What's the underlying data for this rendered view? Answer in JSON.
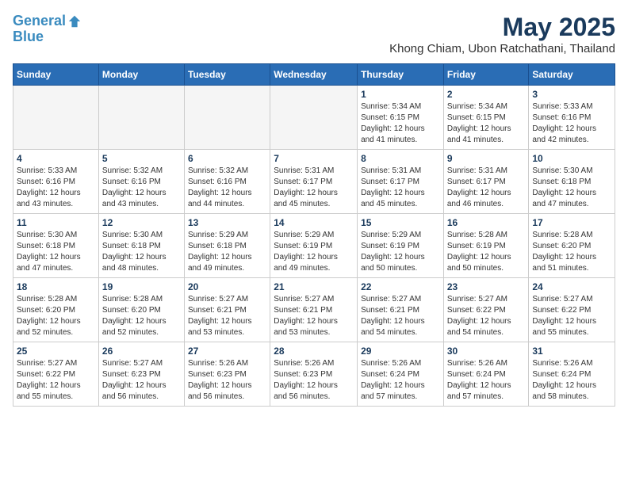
{
  "header": {
    "logo_line1": "General",
    "logo_line2": "Blue",
    "month_title": "May 2025",
    "location": "Khong Chiam, Ubon Ratchathani, Thailand"
  },
  "weekdays": [
    "Sunday",
    "Monday",
    "Tuesday",
    "Wednesday",
    "Thursday",
    "Friday",
    "Saturday"
  ],
  "weeks": [
    [
      {
        "day": "",
        "info": ""
      },
      {
        "day": "",
        "info": ""
      },
      {
        "day": "",
        "info": ""
      },
      {
        "day": "",
        "info": ""
      },
      {
        "day": "1",
        "info": "Sunrise: 5:34 AM\nSunset: 6:15 PM\nDaylight: 12 hours\nand 41 minutes."
      },
      {
        "day": "2",
        "info": "Sunrise: 5:34 AM\nSunset: 6:15 PM\nDaylight: 12 hours\nand 41 minutes."
      },
      {
        "day": "3",
        "info": "Sunrise: 5:33 AM\nSunset: 6:16 PM\nDaylight: 12 hours\nand 42 minutes."
      }
    ],
    [
      {
        "day": "4",
        "info": "Sunrise: 5:33 AM\nSunset: 6:16 PM\nDaylight: 12 hours\nand 43 minutes."
      },
      {
        "day": "5",
        "info": "Sunrise: 5:32 AM\nSunset: 6:16 PM\nDaylight: 12 hours\nand 43 minutes."
      },
      {
        "day": "6",
        "info": "Sunrise: 5:32 AM\nSunset: 6:16 PM\nDaylight: 12 hours\nand 44 minutes."
      },
      {
        "day": "7",
        "info": "Sunrise: 5:31 AM\nSunset: 6:17 PM\nDaylight: 12 hours\nand 45 minutes."
      },
      {
        "day": "8",
        "info": "Sunrise: 5:31 AM\nSunset: 6:17 PM\nDaylight: 12 hours\nand 45 minutes."
      },
      {
        "day": "9",
        "info": "Sunrise: 5:31 AM\nSunset: 6:17 PM\nDaylight: 12 hours\nand 46 minutes."
      },
      {
        "day": "10",
        "info": "Sunrise: 5:30 AM\nSunset: 6:18 PM\nDaylight: 12 hours\nand 47 minutes."
      }
    ],
    [
      {
        "day": "11",
        "info": "Sunrise: 5:30 AM\nSunset: 6:18 PM\nDaylight: 12 hours\nand 47 minutes."
      },
      {
        "day": "12",
        "info": "Sunrise: 5:30 AM\nSunset: 6:18 PM\nDaylight: 12 hours\nand 48 minutes."
      },
      {
        "day": "13",
        "info": "Sunrise: 5:29 AM\nSunset: 6:18 PM\nDaylight: 12 hours\nand 49 minutes."
      },
      {
        "day": "14",
        "info": "Sunrise: 5:29 AM\nSunset: 6:19 PM\nDaylight: 12 hours\nand 49 minutes."
      },
      {
        "day": "15",
        "info": "Sunrise: 5:29 AM\nSunset: 6:19 PM\nDaylight: 12 hours\nand 50 minutes."
      },
      {
        "day": "16",
        "info": "Sunrise: 5:28 AM\nSunset: 6:19 PM\nDaylight: 12 hours\nand 50 minutes."
      },
      {
        "day": "17",
        "info": "Sunrise: 5:28 AM\nSunset: 6:20 PM\nDaylight: 12 hours\nand 51 minutes."
      }
    ],
    [
      {
        "day": "18",
        "info": "Sunrise: 5:28 AM\nSunset: 6:20 PM\nDaylight: 12 hours\nand 52 minutes."
      },
      {
        "day": "19",
        "info": "Sunrise: 5:28 AM\nSunset: 6:20 PM\nDaylight: 12 hours\nand 52 minutes."
      },
      {
        "day": "20",
        "info": "Sunrise: 5:27 AM\nSunset: 6:21 PM\nDaylight: 12 hours\nand 53 minutes."
      },
      {
        "day": "21",
        "info": "Sunrise: 5:27 AM\nSunset: 6:21 PM\nDaylight: 12 hours\nand 53 minutes."
      },
      {
        "day": "22",
        "info": "Sunrise: 5:27 AM\nSunset: 6:21 PM\nDaylight: 12 hours\nand 54 minutes."
      },
      {
        "day": "23",
        "info": "Sunrise: 5:27 AM\nSunset: 6:22 PM\nDaylight: 12 hours\nand 54 minutes."
      },
      {
        "day": "24",
        "info": "Sunrise: 5:27 AM\nSunset: 6:22 PM\nDaylight: 12 hours\nand 55 minutes."
      }
    ],
    [
      {
        "day": "25",
        "info": "Sunrise: 5:27 AM\nSunset: 6:22 PM\nDaylight: 12 hours\nand 55 minutes."
      },
      {
        "day": "26",
        "info": "Sunrise: 5:27 AM\nSunset: 6:23 PM\nDaylight: 12 hours\nand 56 minutes."
      },
      {
        "day": "27",
        "info": "Sunrise: 5:26 AM\nSunset: 6:23 PM\nDaylight: 12 hours\nand 56 minutes."
      },
      {
        "day": "28",
        "info": "Sunrise: 5:26 AM\nSunset: 6:23 PM\nDaylight: 12 hours\nand 56 minutes."
      },
      {
        "day": "29",
        "info": "Sunrise: 5:26 AM\nSunset: 6:24 PM\nDaylight: 12 hours\nand 57 minutes."
      },
      {
        "day": "30",
        "info": "Sunrise: 5:26 AM\nSunset: 6:24 PM\nDaylight: 12 hours\nand 57 minutes."
      },
      {
        "day": "31",
        "info": "Sunrise: 5:26 AM\nSunset: 6:24 PM\nDaylight: 12 hours\nand 58 minutes."
      }
    ]
  ]
}
